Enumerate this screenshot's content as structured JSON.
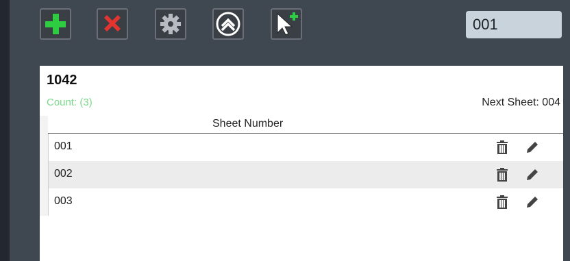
{
  "toolbar": {
    "buttons": [
      {
        "name": "add",
        "icon": "plus-icon",
        "color": "#2ecc40"
      },
      {
        "name": "delete",
        "icon": "x-icon",
        "color": "#e3342f"
      },
      {
        "name": "settings",
        "icon": "gear-icon",
        "color": "#b8bcc2"
      },
      {
        "name": "collapse",
        "icon": "chevron-up-icon",
        "color": "#ffffff"
      },
      {
        "name": "select-add",
        "icon": "cursor-plus-icon",
        "color": "#ffffff"
      }
    ],
    "sheet_field_value": "001"
  },
  "panel": {
    "title": "1042",
    "count_label": "Count: (3)",
    "next_sheet_label": "Next Sheet: 004",
    "column_header": "Sheet Number",
    "rows": [
      {
        "number": "001"
      },
      {
        "number": "002"
      },
      {
        "number": "003"
      }
    ]
  },
  "colors": {
    "background": "#3f4751",
    "count_green": "#7bd88b",
    "input_bg": "#c9d3dc"
  }
}
